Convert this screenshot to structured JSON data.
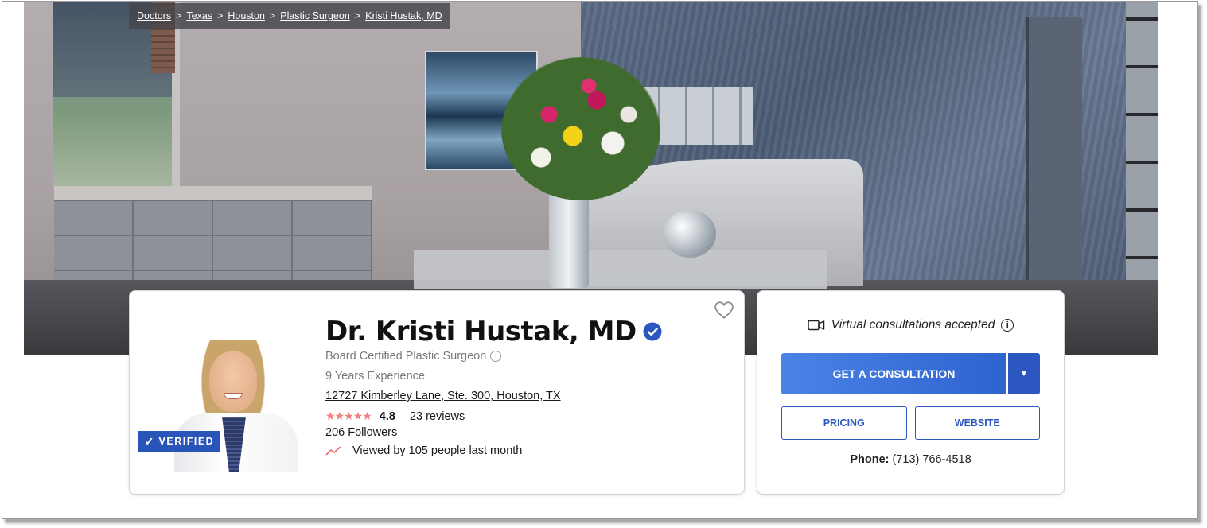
{
  "breadcrumb": {
    "items": [
      "Doctors",
      "Texas",
      "Houston",
      "Plastic Surgeon",
      "Kristi Hustak, MD"
    ],
    "separator": ">"
  },
  "profile": {
    "name": "Dr. Kristi Hustak, MD",
    "verified_badge": "VERIFIED",
    "specialty": "Board Certified Plastic Surgeon",
    "experience": "9 Years Experience",
    "address": "12727 Kimberley Lane, Ste. 300, Houston, TX",
    "stars": "★★★★★",
    "rating": "4.8",
    "rating_out_of_5": 4.8,
    "reviews": "23 reviews",
    "followers": "206 Followers",
    "viewed": "Viewed by 105 people last month"
  },
  "actions": {
    "virtual_text": "Virtual consultations accepted",
    "consult_label": "GET A CONSULTATION",
    "pricing_label": "PRICING",
    "website_label": "WEBSITE",
    "phone_label": "Phone:",
    "phone_number": "(713) 766-4518"
  },
  "icons": {
    "favorite": "heart-icon",
    "verified": "verified-check-icon",
    "info": "info-icon",
    "trend": "trending-up-icon",
    "video": "video-camera-icon",
    "dropdown": "chevron-down-icon"
  },
  "colors": {
    "primary": "#2c56c0",
    "primary_light": "#4a82e6",
    "verified_badge": "#2a55b8",
    "stars": "#f07f7f",
    "trend": "#e86a6a"
  }
}
